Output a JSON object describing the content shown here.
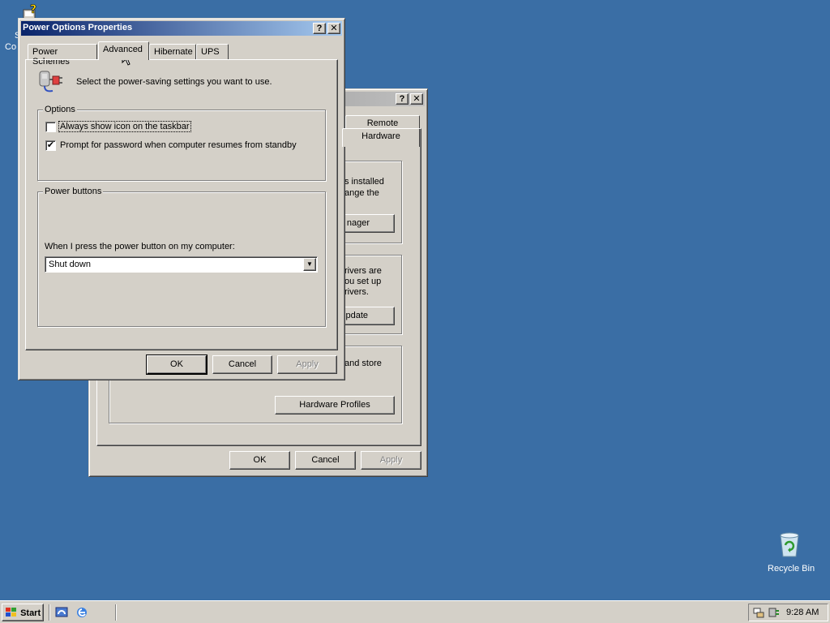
{
  "desktop": {
    "top_left_icon_label_fragments": [
      "Sy",
      "Co"
    ],
    "recycle_bin_label": "Recycle Bin"
  },
  "back_window": {
    "tabs": [
      "Remote",
      "Hardware"
    ],
    "text_fragments": {
      "device_manager_1": "s installed",
      "device_manager_2": "ange the",
      "device_manager_btn": "nager",
      "drivers_1": "rivers are",
      "drivers_2": "ou set up",
      "drivers_3": "rivers.",
      "windows_update_btn": "pdate",
      "profiles_1": "and store"
    },
    "hardware_profiles_btn": "Hardware Profiles",
    "ok": "OK",
    "cancel": "Cancel",
    "apply": "Apply",
    "help": "?",
    "close": "✕"
  },
  "dialog": {
    "title": "Power Options Properties",
    "help": "?",
    "close": "✕",
    "tabs": {
      "power_schemes": "Power Schemes",
      "advanced": "Advanced",
      "hibernate": "Hibernate",
      "ups": "UPS"
    },
    "intro": "Select the power-saving settings you want to use.",
    "options": {
      "label": "Options",
      "always_show_icon": {
        "label": "Always show icon on the taskbar",
        "checked": false,
        "mark": ""
      },
      "prompt_password": {
        "label": "Prompt for password when computer resumes from standby",
        "checked": true,
        "mark": "✔"
      }
    },
    "power_buttons": {
      "label": "Power buttons",
      "prompt": "When I press the power button on my computer:",
      "selected": "Shut down",
      "arrow": "▼"
    },
    "ok": "OK",
    "cancel": "Cancel",
    "apply": "Apply"
  },
  "taskbar": {
    "start_label": "Start",
    "clock": "9:28 AM"
  },
  "icons": {
    "start": "windows-flag-icon",
    "quicklaunch": [
      "show-desktop-icon",
      "internet-explorer-icon"
    ],
    "tray": [
      "network-icon",
      "power-icon"
    ]
  },
  "colors": {
    "desktop": "#3a6ea5",
    "title_active_start": "#0a246a",
    "title_active_end": "#a6caf0",
    "face": "#d4d0c8"
  }
}
